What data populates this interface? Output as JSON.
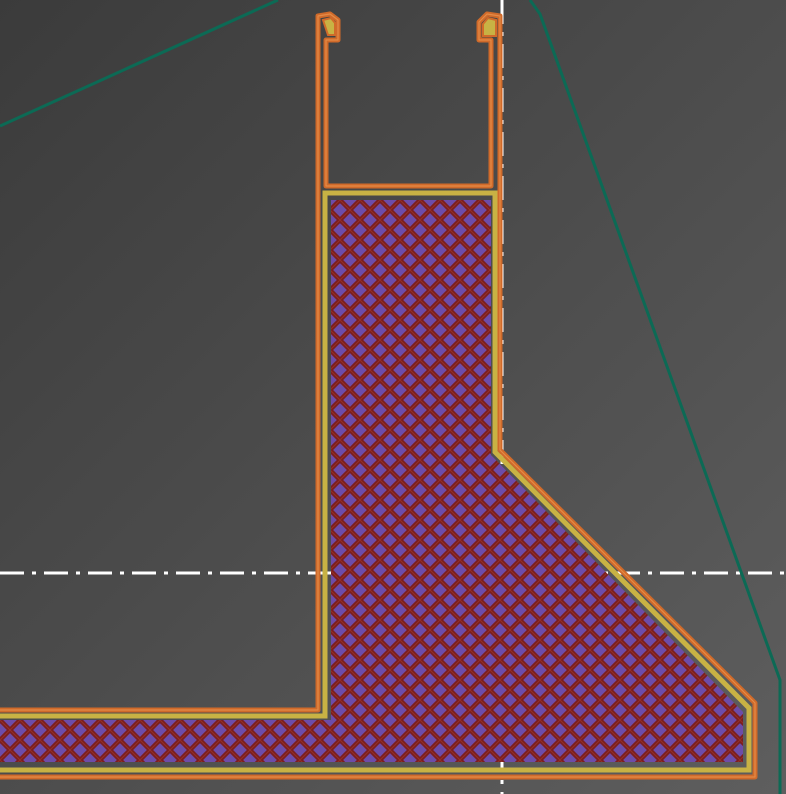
{
  "viewer": {
    "background_color": "#4a4a4a",
    "bed_gradient": [
      "#3c3c3c",
      "#5c5c5c"
    ],
    "skirt_color": "#0c6a55",
    "axis_line_color": "#ffffff",
    "feature_colors": {
      "external_perimeter": "#d06a2a",
      "perimeter": "#c8b244",
      "solid_infill": "#7a1d1d",
      "infill_gap": "#6d4ca8"
    },
    "features_shown": [
      "skirt",
      "external-perimeter",
      "perimeter",
      "solid-infill"
    ]
  }
}
